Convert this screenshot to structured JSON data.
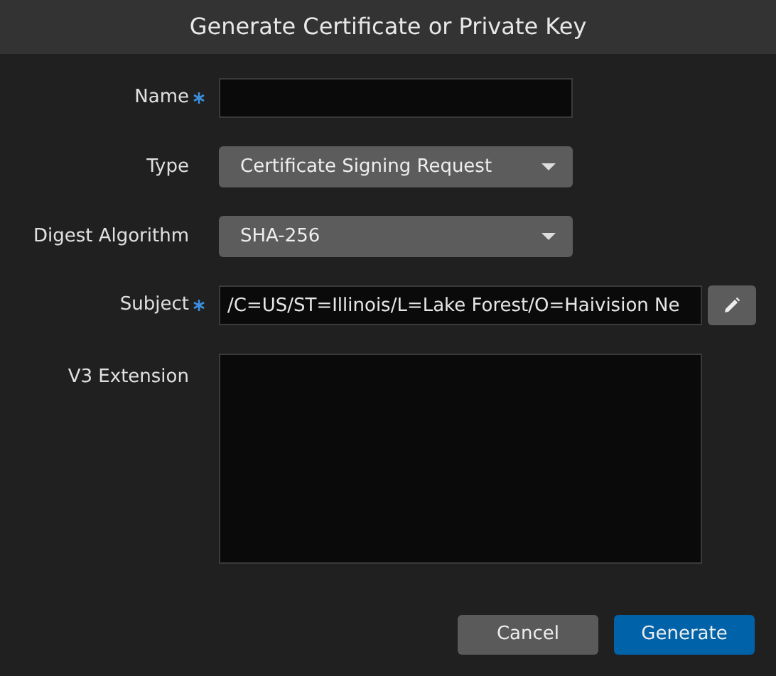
{
  "dialog": {
    "title": "Generate Certificate or Private Key"
  },
  "fields": [
    {
      "kind": "text",
      "label": "Name",
      "required": true
    },
    {
      "kind": "select",
      "label": "Type",
      "required": false,
      "value": "Certificate Signing Request"
    },
    {
      "kind": "select",
      "label": "Digest Algorithm",
      "required": false,
      "value": "SHA-256"
    },
    {
      "kind": "edit",
      "label": "Subject",
      "required": true,
      "value": "/C=US/ST=Illinois/L=Lake Forest/O=Haivision Ne"
    },
    {
      "kind": "textarea",
      "label": "V3 Extension",
      "required": false
    }
  ],
  "buttons": [
    {
      "label": "Cancel",
      "kind": "secondary"
    },
    {
      "label": "Generate",
      "kind": "primary"
    }
  ]
}
